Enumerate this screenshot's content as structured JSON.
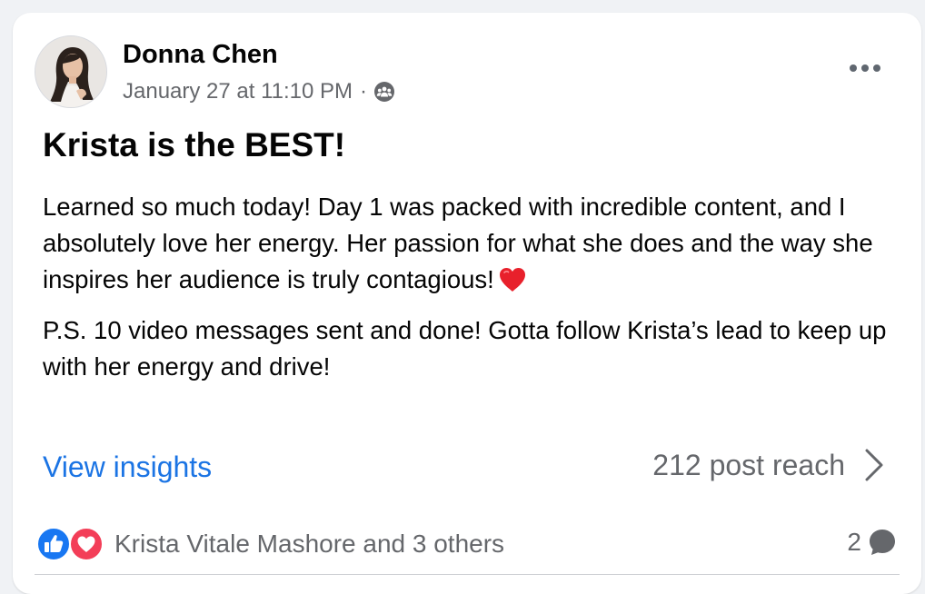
{
  "post": {
    "author": "Donna Chen",
    "timestamp": "January 27 at 11:10 PM",
    "separator": "·",
    "audience_icon": "group-icon",
    "menu_icon": "more-horizontal-icon",
    "title": "Krista is the BEST!",
    "body": [
      "Learned so much today! Day 1 was packed with incredible content, and I absolutely love her energy. Her passion for what she does and the way she inspires her audience is truly contagious!",
      "P.S. 10 video messages sent and done! Gotta follow Krista’s lead to keep up with her energy and drive!"
    ],
    "body_emoji": "red-heart-icon"
  },
  "insights": {
    "link_label": "View insights",
    "reach_label": "212 post reach"
  },
  "engagement": {
    "reaction_icons": [
      "like-icon",
      "love-icon"
    ],
    "reactions_text": "Krista Vitale Mashore and 3 others",
    "comment_count": "2"
  },
  "colors": {
    "link_blue": "#1b74e4",
    "secondary_text": "#65676b",
    "like_blue": "#1877f2",
    "love_red": "#f33e58"
  }
}
